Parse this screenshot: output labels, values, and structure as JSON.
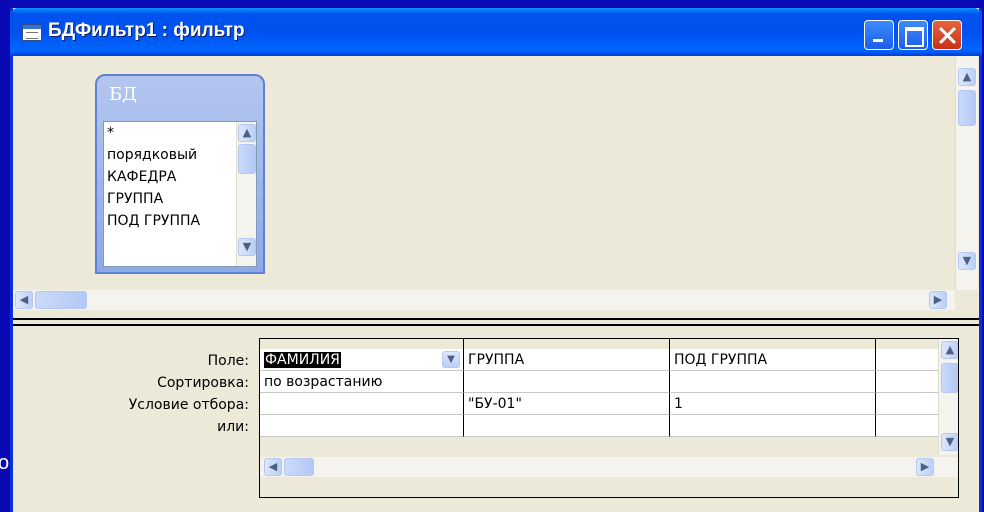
{
  "window": {
    "title": "БДФильтр1 : фильтр"
  },
  "background_fragment": "о",
  "table": {
    "name": "БД",
    "fields": [
      "*",
      "порядковый",
      "КАФЕДРА",
      "ГРУППА",
      "ПОД ГРУППА"
    ]
  },
  "grid": {
    "row_labels": {
      "field": "Поле:",
      "sort": "Сортировка:",
      "criteria": "Условие отбора:",
      "or": "или:"
    },
    "columns": [
      {
        "field": "ФАМИЛИЯ",
        "sort": "по возрастанию",
        "criteria": "",
        "or": ""
      },
      {
        "field": "ГРУППА",
        "sort": "",
        "criteria": "\"БУ-01\"",
        "or": ""
      },
      {
        "field": "ПОД ГРУППА",
        "sort": "",
        "criteria": "1",
        "or": ""
      },
      {
        "field": "",
        "sort": "",
        "criteria": "",
        "or": ""
      }
    ]
  },
  "icons": {
    "window": "query-window-icon",
    "minimize": "minimize-icon",
    "maximize": "maximize-icon",
    "close": "close-icon"
  },
  "colors": {
    "desktop": "#0a0ab4",
    "titlebar": "#0053ee",
    "close": "#c53118",
    "face": "#ece9d8"
  }
}
